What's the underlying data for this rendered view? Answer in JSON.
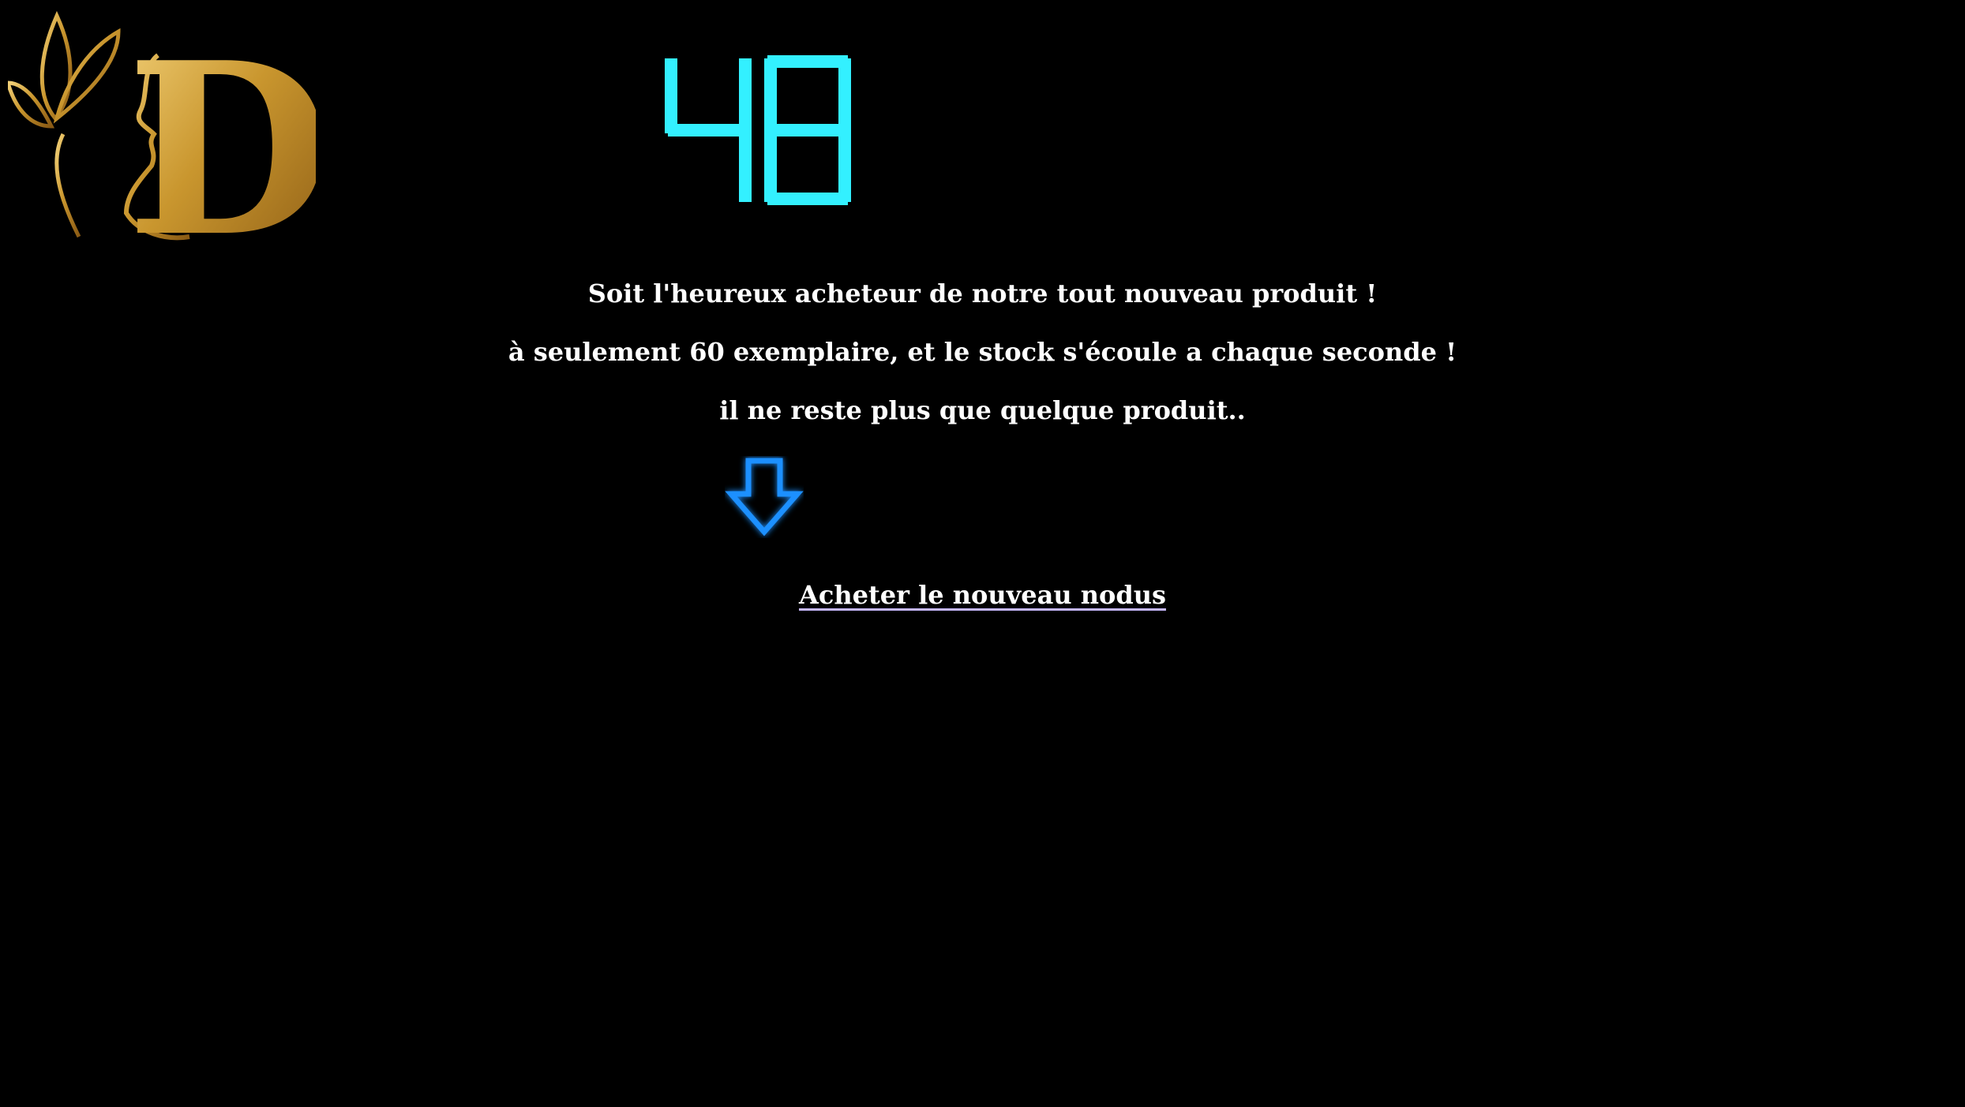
{
  "colors": {
    "background": "#000000",
    "text": "#ffffff",
    "counter": "#33f0ff",
    "arrow": "#1e90ff",
    "logo_gold": "#c9962e"
  },
  "logo": {
    "icon": "gold-d-face-leaves-logo",
    "letter": "D"
  },
  "counter": {
    "value": "48",
    "icon": "seven-segment-display"
  },
  "messages": {
    "line1": "Soit l'heureux acheteur de notre tout nouveau produit !",
    "line2": "à seulement 60 exemplaire, et le stock s'écoule a chaque seconde !",
    "line3": "il ne reste plus que quelque produit.."
  },
  "arrow": {
    "icon": "down-arrow-icon"
  },
  "cta": {
    "label": "Acheter le nouveau nodus"
  }
}
